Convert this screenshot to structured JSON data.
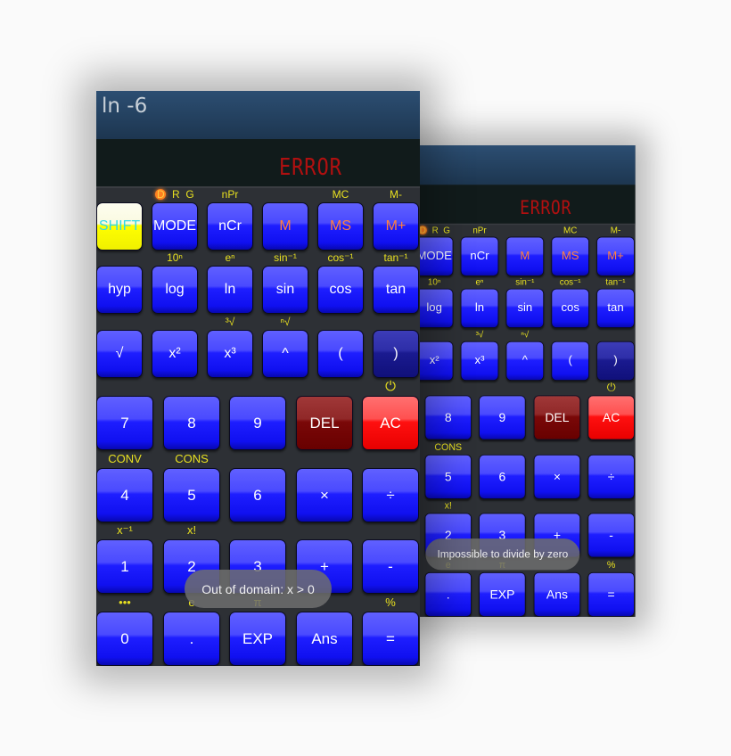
{
  "colors": {
    "key_blue": "#2a2aff",
    "label_yellow": "#e8e020",
    "error_red": "#b01010",
    "keypad_bg": "#2d3035"
  },
  "phones": [
    {
      "id": "back",
      "title": "",
      "result": "ERROR",
      "toast": "Impossible to divide by zero"
    },
    {
      "id": "front",
      "title": "ln -6",
      "result": "ERROR",
      "toast": "Out of domain: x > 0"
    }
  ],
  "keypad": {
    "small_rows": [
      {
        "labels": [
          "",
          "DRG",
          "nPr",
          "",
          "MC",
          "M-"
        ],
        "keys": [
          "SHIFT",
          "MODE",
          "nCr",
          "M",
          "MS",
          "M+"
        ]
      },
      {
        "labels": [
          "",
          "10ⁿ",
          "eⁿ",
          "sin⁻¹",
          "cos⁻¹",
          "tan⁻¹"
        ],
        "keys": [
          "hyp",
          "log",
          "ln",
          "sin",
          "cos",
          "tan"
        ]
      },
      {
        "labels": [
          "",
          "",
          "³√",
          "ⁿ√",
          "",
          ""
        ],
        "keys": [
          "√",
          "x²",
          "x³",
          "^",
          "(",
          ")"
        ]
      }
    ],
    "angle_modes": [
      "D",
      "R",
      "G"
    ],
    "big_rows": [
      {
        "labels": [
          "",
          "",
          "",
          "",
          "⏻"
        ],
        "keys": [
          "7",
          "8",
          "9",
          "DEL",
          "AC"
        ]
      },
      {
        "labels": [
          "CONV",
          "CONS",
          "",
          "",
          ""
        ],
        "keys": [
          "4",
          "5",
          "6",
          "×",
          "÷"
        ]
      },
      {
        "labels": [
          "x⁻¹",
          "x!",
          "",
          "",
          ""
        ],
        "keys": [
          "1",
          "2",
          "3",
          "+",
          "-"
        ]
      },
      {
        "labels": [
          "•••",
          "e",
          "π",
          "",
          "%"
        ],
        "keys": [
          "0",
          ".",
          "EXP",
          "Ans",
          "="
        ]
      }
    ],
    "power_icon": "power-icon"
  }
}
